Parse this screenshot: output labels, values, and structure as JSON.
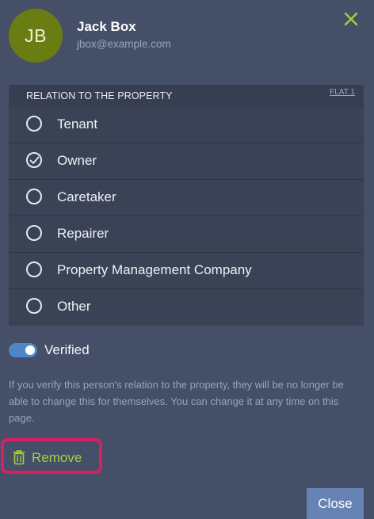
{
  "user": {
    "initials": "JB",
    "name": "Jack Box",
    "email": "jbox@example.com",
    "avatar_color": "#6a7d12"
  },
  "close_icon": "close-x-icon",
  "relation": {
    "title": "RELATION TO THE PROPERTY",
    "link": "FLAT 1",
    "options": [
      {
        "label": "Tenant",
        "selected": false
      },
      {
        "label": "Owner",
        "selected": true
      },
      {
        "label": "Caretaker",
        "selected": false
      },
      {
        "label": "Repairer",
        "selected": false
      },
      {
        "label": "Property Management Company",
        "selected": false
      },
      {
        "label": "Other",
        "selected": false
      }
    ]
  },
  "verified": {
    "label": "Verified",
    "on": true,
    "help": "If you verify this person's relation to the property, they will be no longer be able to change this for themselves. You can change it at any time on this page."
  },
  "actions": {
    "remove_label": "Remove",
    "remove_icon": "trash-icon",
    "close_label": "Close"
  },
  "colors": {
    "accent_green": "#a8cf3c",
    "highlight": "#d71f63",
    "toggle_on": "#4f86c6",
    "close_button": "#6683b4"
  }
}
